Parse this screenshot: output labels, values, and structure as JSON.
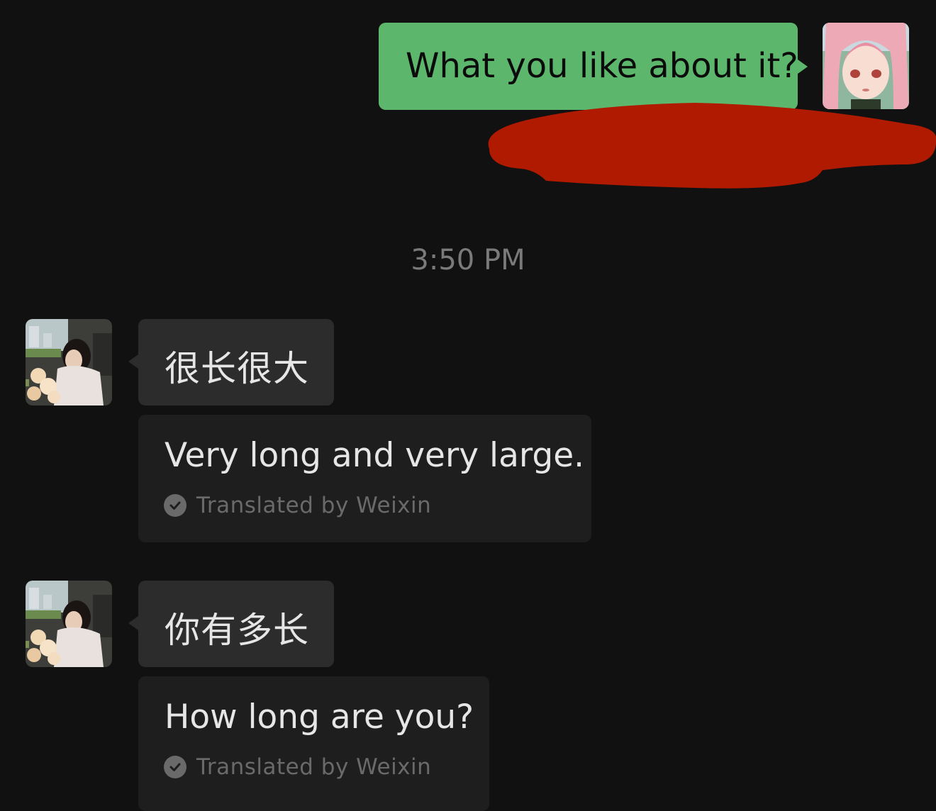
{
  "outgoing": {
    "text": "What you like about it?",
    "bubble_color": "#5cb76c"
  },
  "timestamp": "3:50 PM",
  "incoming": [
    {
      "original": "很长很大",
      "translation": "Very long and very large.",
      "credit": "Translated by Weixin"
    },
    {
      "original": "你有多长",
      "translation": "How long are you?",
      "credit": "Translated by Weixin"
    }
  ],
  "colors": {
    "background": "#111111",
    "incoming_bubble": "#2c2c2c",
    "translation_box": "#1e1e1e",
    "redaction": "#b01a00"
  }
}
